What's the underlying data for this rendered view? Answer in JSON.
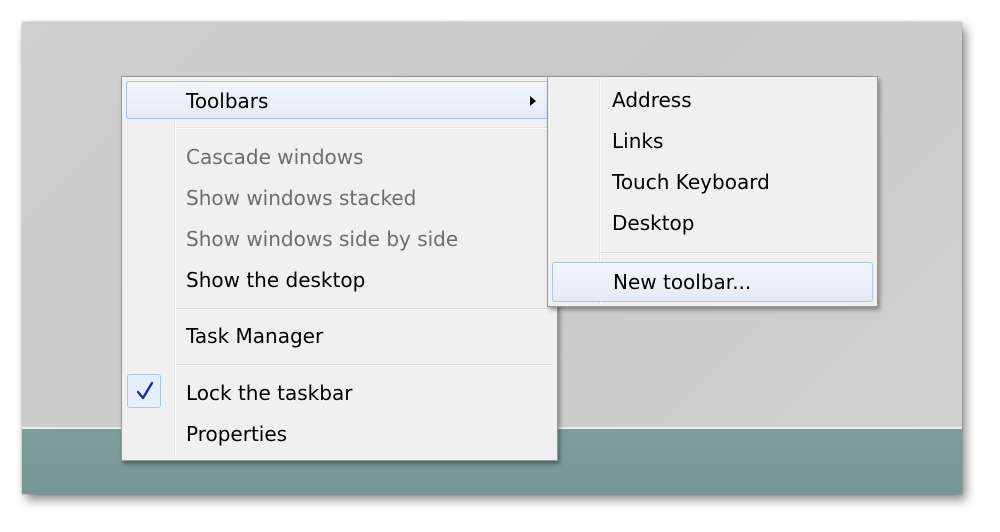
{
  "context_menu": {
    "items": [
      {
        "label": "Toolbars",
        "enabled": true,
        "submenu": true,
        "highlighted": true
      },
      {
        "label": "Cascade windows",
        "enabled": false
      },
      {
        "label": "Show windows stacked",
        "enabled": false
      },
      {
        "label": "Show windows side by side",
        "enabled": false
      },
      {
        "label": "Show the desktop",
        "enabled": true
      },
      {
        "label": "Task Manager",
        "enabled": true
      },
      {
        "label": "Lock the taskbar",
        "enabled": true,
        "checked": true
      },
      {
        "label": "Properties",
        "enabled": true
      }
    ]
  },
  "toolbars_submenu": {
    "items": [
      {
        "label": "Address"
      },
      {
        "label": "Links"
      },
      {
        "label": "Touch Keyboard"
      },
      {
        "label": "Desktop"
      },
      {
        "label": "New toolbar...",
        "highlighted": true
      }
    ]
  },
  "colors": {
    "menu_background": "#f0f0f0",
    "highlight_border": "#a8c4e6",
    "taskbar": "#7f9c9c",
    "checkmark": "#1f2f9a"
  },
  "icons": {
    "submenu_arrow": "chevron-right-icon",
    "check": "checkmark-icon"
  }
}
